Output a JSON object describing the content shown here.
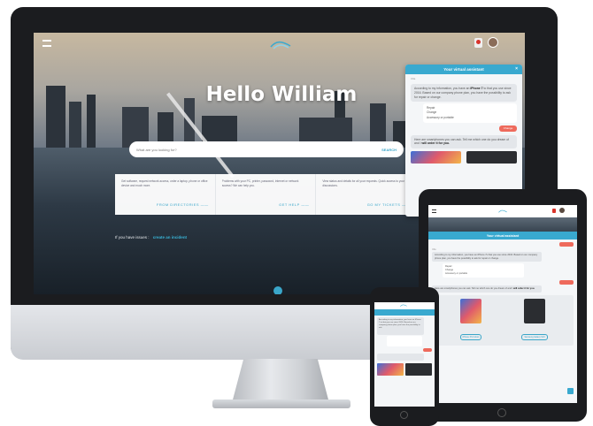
{
  "desktop": {
    "hero_title": "Hello William",
    "search": {
      "placeholder": "What are you looking for?",
      "button_label": "SEARCH"
    },
    "cards": [
      {
        "text": "Get software, request network access, order a laptop, phone or office device and much more.",
        "link": "FROM DIRECTORIES"
      },
      {
        "text": "Problems with your PC, printer, password, internet or network access? We can help you.",
        "link": "GET HELP"
      },
      {
        "text": "View status and details for all your requests. Quick access to your discussions.",
        "link": "GO MY TICKETS"
      }
    ],
    "issue_prompt": "If you have issues :",
    "issue_link": "create an incident",
    "chat": {
      "title": "Your virtual assistant",
      "sender": "Olla",
      "message_1": "According to my information, you have an",
      "message_1_bold": "iPhone 7",
      "message_1_rest": "to that you use since 2016. Based on our company phone plan, you have the possibility to ask for repair or change.",
      "options": [
        "Repair",
        "Change",
        "Accessory or portable"
      ],
      "user_reply": "Change",
      "message_2": "Here are smartphones you can ask. Tell me which one do you dream of and I",
      "message_2_bold": "will order it for you."
    }
  },
  "tablet": {
    "chat_title": "Your virtual assistant",
    "sender": "Olla",
    "message_1": "According to my information, you have an iPhone 7s that you use since 2016. Based on our company phone plan, you have the possibility to ask for repair or change.",
    "options": [
      "Repair",
      "Change",
      "Accessory or portable"
    ],
    "message_2": "Here are smartphones you can ask. Tell me which one do you dream of and I",
    "message_2_bold": "will order it for you.",
    "products": [
      {
        "button": "iPhone XS Colors"
      },
      {
        "button": "Samsung Galaxy S10"
      }
    ]
  },
  "phone": {
    "message_1": "According to my information, you have an iPhone 7 to that you use since 2016. Based on our company phone plan, you have the possibility to ask."
  },
  "colors": {
    "accent": "#39a9cf",
    "user_bubble": "#ee6a5c",
    "device_frame": "#1b1c1f"
  }
}
